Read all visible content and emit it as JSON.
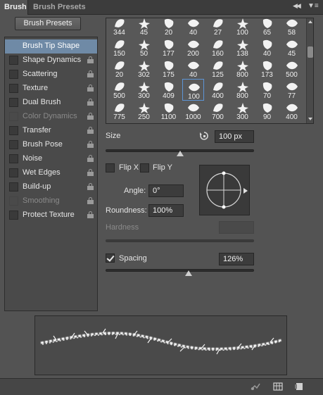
{
  "tabs": {
    "brush": "Brush",
    "brush_presets": "Brush Presets"
  },
  "presets_button": "Brush Presets",
  "sidebar": {
    "items": [
      {
        "label": "Brush Tip Shape",
        "active": true,
        "disabled": false,
        "lock": false
      },
      {
        "label": "Shape Dynamics",
        "active": false,
        "disabled": false,
        "lock": true
      },
      {
        "label": "Scattering",
        "active": false,
        "disabled": false,
        "lock": true
      },
      {
        "label": "Texture",
        "active": false,
        "disabled": false,
        "lock": true
      },
      {
        "label": "Dual Brush",
        "active": false,
        "disabled": false,
        "lock": true
      },
      {
        "label": "Color Dynamics",
        "active": false,
        "disabled": true,
        "lock": true
      },
      {
        "label": "Transfer",
        "active": false,
        "disabled": false,
        "lock": true
      },
      {
        "label": "Brush Pose",
        "active": false,
        "disabled": false,
        "lock": true
      },
      {
        "label": "Noise",
        "active": false,
        "disabled": false,
        "lock": true
      },
      {
        "label": "Wet Edges",
        "active": false,
        "disabled": false,
        "lock": true
      },
      {
        "label": "Build-up",
        "active": false,
        "disabled": false,
        "lock": true
      },
      {
        "label": "Smoothing",
        "active": false,
        "disabled": true,
        "lock": true
      },
      {
        "label": "Protect Texture",
        "active": false,
        "disabled": false,
        "lock": true
      }
    ]
  },
  "brush_grid": {
    "rows": [
      [
        "344",
        "45",
        "20",
        "40",
        "27",
        "100",
        "65",
        "58"
      ],
      [
        "150",
        "50",
        "177",
        "200",
        "160",
        "138",
        "40",
        "45"
      ],
      [
        "20",
        "302",
        "175",
        "40",
        "125",
        "800",
        "173",
        "500"
      ],
      [
        "500",
        "300",
        "409",
        "100",
        "400",
        "800",
        "70",
        "77"
      ],
      [
        "775",
        "250",
        "1100",
        "1000",
        "700",
        "300",
        "90",
        "400"
      ]
    ],
    "selected": "100"
  },
  "size": {
    "label": "Size",
    "value": "100 px",
    "slider_fraction": 0.5
  },
  "flip_x": {
    "label": "Flip X",
    "checked": false
  },
  "flip_y": {
    "label": "Flip Y",
    "checked": false
  },
  "angle": {
    "label": "Angle:",
    "value": "0°"
  },
  "roundness": {
    "label": "Roundness:",
    "value": "100%"
  },
  "hardness": {
    "label": "Hardness",
    "value": ""
  },
  "spacing": {
    "label": "Spacing",
    "checked": true,
    "value": "126%",
    "slider_fraction": 0.56
  },
  "icons": {
    "collapse": "double-chevron-left-icon",
    "menu": "panel-menu-icon",
    "reset": "reset-icon",
    "lock": "lock-icon",
    "bottom": [
      "toggle-live-tip-icon",
      "brush-grid-icon",
      "new-brush-icon"
    ]
  },
  "colors": {
    "panel": "#535353",
    "active_item": "#6f8aa6",
    "selected_border": "#5d95d6"
  }
}
